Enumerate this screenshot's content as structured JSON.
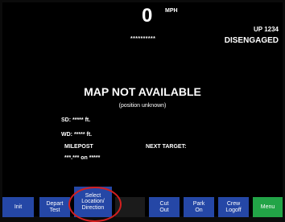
{
  "header": {
    "speed": "0",
    "speed_unit": "MPH",
    "speed_mask": "**********",
    "train_id": "UP 1234",
    "engage_status": "DISENGAGED"
  },
  "map": {
    "title": "MAP NOT AVAILABLE",
    "subtitle": "(position unknown)"
  },
  "info": {
    "sd": "SD:  ***** ft.",
    "wd": "WD:  ***** ft.",
    "milepost_label": "MILEPOST",
    "next_target_label": "NEXT TARGET:",
    "milepost_value": "***.*** on *****"
  },
  "buttons": [
    {
      "label": "Init"
    },
    {
      "label": "Depart\nTest"
    },
    {
      "label": "Select\nLocation/\nDirection"
    },
    {
      "label": ""
    },
    {
      "label": "Cut\nOut"
    },
    {
      "label": "Park\nOn"
    },
    {
      "label": "Crew\nLogoff"
    },
    {
      "label": "Menu"
    }
  ],
  "colors": {
    "button_blue": "#2547a6",
    "menu_green": "#22a447",
    "highlight_red": "#d31f1f",
    "background": "#000000"
  }
}
